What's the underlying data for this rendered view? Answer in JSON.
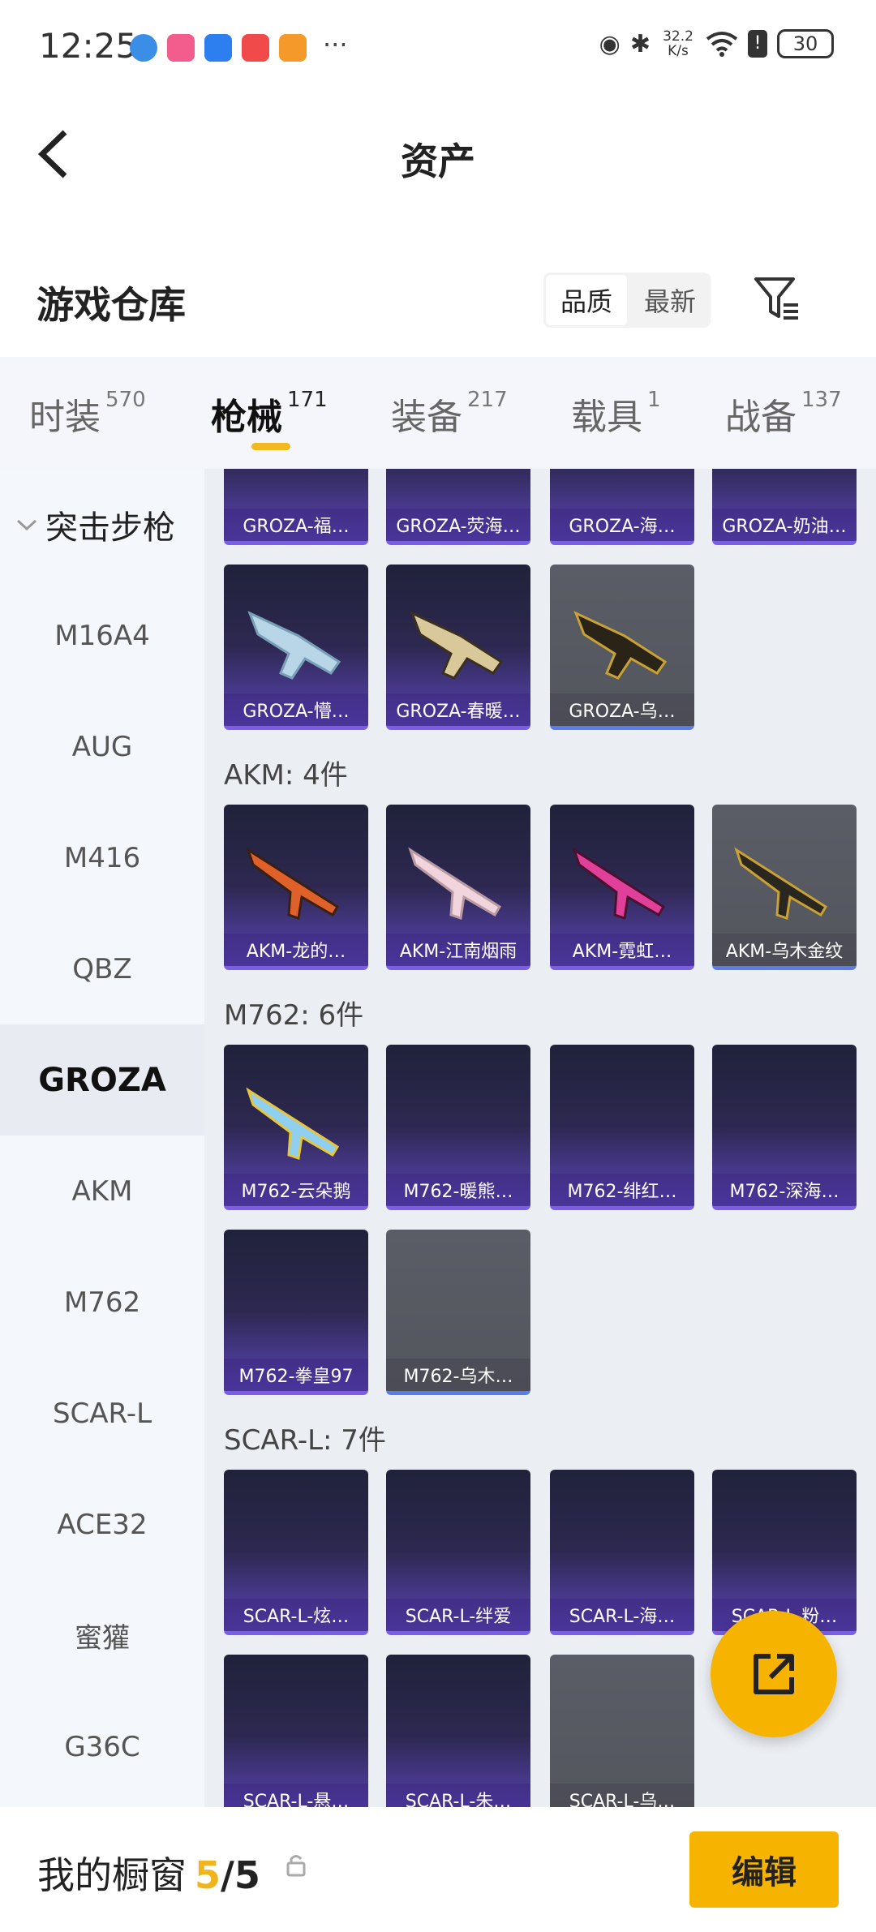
{
  "status": {
    "time": "12:25",
    "more": "···",
    "speed_value": "32.2",
    "speed_unit": "K/s",
    "battery": "30"
  },
  "header": {
    "title": "资产"
  },
  "section": {
    "title": "游戏仓库",
    "sort_options": [
      "品质",
      "最新"
    ],
    "sort_selected": "品质"
  },
  "tabs": [
    {
      "label": "时装",
      "count": "570"
    },
    {
      "label": "枪械",
      "count": "171"
    },
    {
      "label": "装备",
      "count": "217"
    },
    {
      "label": "载具",
      "count": "1"
    },
    {
      "label": "战备",
      "count": "137"
    }
  ],
  "sidebar": {
    "category": "突击步枪",
    "items": [
      "M16A4",
      "AUG",
      "M416",
      "QBZ",
      "GROZA",
      "AKM",
      "M762",
      "SCAR-L",
      "ACE32",
      "蜜獾",
      "G36C"
    ],
    "active": "GROZA"
  },
  "groups": {
    "groza_row1": [
      "GROZA-福…",
      "GROZA-荧海…",
      "GROZA-海…",
      "GROZA-奶油…"
    ],
    "groza_row2": [
      "GROZA-懵…",
      "GROZA-春暖…",
      "GROZA-乌…"
    ],
    "akm_label": "AKM: 4件",
    "akm": [
      "AKM-龙的…",
      "AKM-江南烟雨",
      "AKM-霓虹…",
      "AKM-乌木金纹"
    ],
    "m762_label": "M762: 6件",
    "m762_row1": [
      "M762-云朵鹅",
      "M762-暖熊…",
      "M762-绯红…",
      "M762-深海…"
    ],
    "m762_row2": [
      "M762-拳皇97",
      "M762-乌木…"
    ],
    "scar_label": "SCAR-L: 7件",
    "scar_row1": [
      "SCAR-L-炫…",
      "SCAR-L-绊爱",
      "SCAR-L-海…",
      "SCAR-L-粉…"
    ],
    "scar_row2": [
      "SCAR-L-悬…",
      "SCAR-L-朱…",
      "SCAR-L-乌…"
    ]
  },
  "bottom": {
    "title": "我的橱窗",
    "current": "5",
    "total": "5",
    "separator": "/",
    "edit_label": "编辑"
  },
  "colors": {
    "accent": "#f6b400",
    "card_purple": "#5b45b8",
    "card_gray": "#54565e"
  }
}
